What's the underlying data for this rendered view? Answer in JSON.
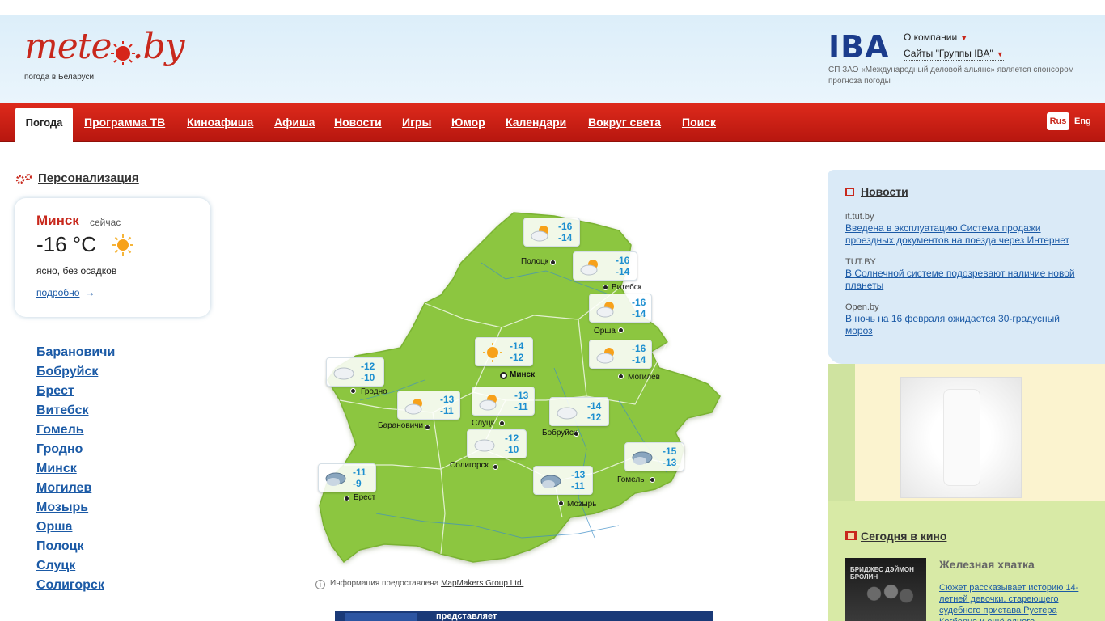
{
  "header": {
    "logo_text": "mete by",
    "logo_tagline": "погода в Беларуси",
    "iba_logo": "IBA",
    "about_link": "О компании",
    "group_link": "Сайты \"Группы IBA\"",
    "sponsor_note": "СП ЗАО «Международный деловой альянс» является спонсором прогноза погоды"
  },
  "nav": {
    "active": "Погода",
    "items": [
      "Программа ТВ",
      "Киноафиша",
      "Афиша",
      "Новости",
      "Игры",
      "Юмор",
      "Календари",
      "Вокруг света",
      "Поиск"
    ],
    "lang_ru": "Rus",
    "lang_en": "Eng"
  },
  "personal": {
    "label": "Персонализация"
  },
  "current": {
    "city": "Минск",
    "when": "сейчас",
    "temp": "-16 °C",
    "icon": "sun-icon",
    "desc": "ясно, без осадков",
    "more": "подробно"
  },
  "cities": [
    "Барановичи",
    "Бобруйск",
    "Брест",
    "Витебск",
    "Гомель",
    "Гродно",
    "Минск",
    "Могилев",
    "Мозырь",
    "Орша",
    "Полоцк",
    "Слуцк",
    "Солигорск"
  ],
  "map": {
    "points": [
      {
        "city": "Полоцк",
        "t1": "-16",
        "t2": "-14",
        "icon": "partly-cloudy"
      },
      {
        "city": "Витебск",
        "t1": "-16",
        "t2": "-14",
        "icon": "partly-cloudy"
      },
      {
        "city": "Орша",
        "t1": "-16",
        "t2": "-14",
        "icon": "partly-cloudy"
      },
      {
        "city": "Могилев",
        "t1": "-16",
        "t2": "-14",
        "icon": "partly-cloudy"
      },
      {
        "city": "Минск",
        "t1": "-14",
        "t2": "-12",
        "icon": "sun"
      },
      {
        "city": "Гродно",
        "t1": "-12",
        "t2": "-10",
        "icon": "cloudy"
      },
      {
        "city": "Барановичи",
        "t1": "-13",
        "t2": "-11",
        "icon": "partly-cloudy"
      },
      {
        "city": "Слуцк",
        "t1": "-13",
        "t2": "-11",
        "icon": "partly-cloudy"
      },
      {
        "city": "Бобруйск",
        "t1": "-14",
        "t2": "-12",
        "icon": "cloudy"
      },
      {
        "city": "Солигорск",
        "t1": "-12",
        "t2": "-10",
        "icon": "cloudy"
      },
      {
        "city": "Гомель",
        "t1": "-15",
        "t2": "-13",
        "icon": "overcast"
      },
      {
        "city": "Брест",
        "t1": "-11",
        "t2": "-9",
        "icon": "overcast"
      },
      {
        "city": "Мозырь",
        "t1": "-13",
        "t2": "-11",
        "icon": "overcast"
      }
    ],
    "source_prefix": "Информация предоставлена",
    "source_link": "MapMakers Group Ltd."
  },
  "banner": {
    "text": "представляет"
  },
  "news": {
    "title": "Новости",
    "items": [
      {
        "source": "it.tut.by",
        "headline": "Введена в эксплуатацию Система продажи проездных документов на поезда через Интернет"
      },
      {
        "source": "TUT.BY",
        "headline": "В Солнечной системе подозревают наличие новой планеты"
      },
      {
        "source": "Open.by",
        "headline": "В ночь на 16 февраля ожидается 30-градусный мороз"
      }
    ]
  },
  "cinema": {
    "title": "Сегодня в кино",
    "movie": "Железная хватка",
    "poster_text": "БРИДЖЕС ДЭЙМОН БРОЛИН",
    "desc": "Сюжет рассказывает историю 14-летней девочки, стареющего судебного пристава Рустера Когберна и ещё одного"
  },
  "colors": {
    "brand_red": "#c8281c",
    "link_blue": "#1b5aa6",
    "temp_blue": "#1d8fd0",
    "map_green": "#8cc640"
  }
}
